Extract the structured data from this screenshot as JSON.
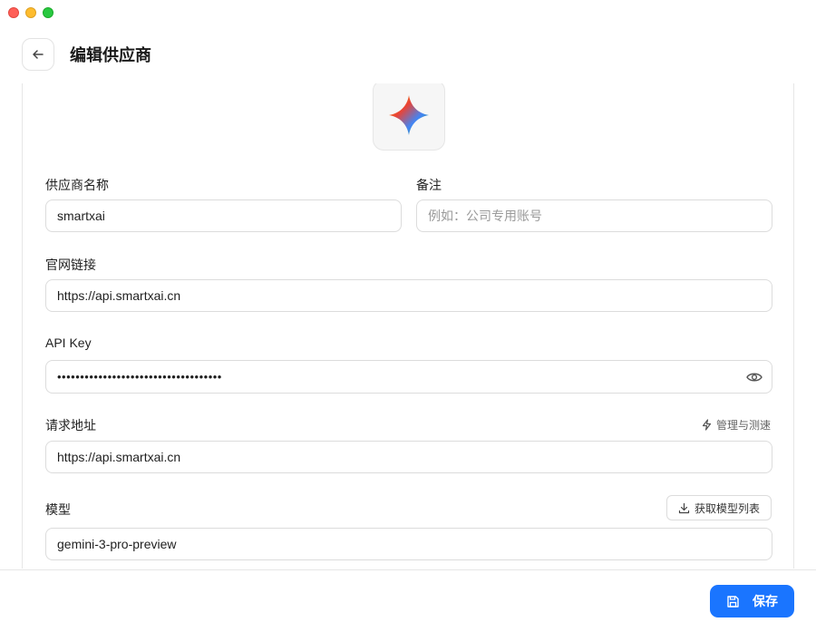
{
  "header": {
    "title": "编辑供应商"
  },
  "form": {
    "provider_name": {
      "label": "供应商名称",
      "value": "smartxai"
    },
    "note": {
      "label": "备注",
      "placeholder": "例如：公司专用账号"
    },
    "website": {
      "label": "官网链接",
      "value": "https://api.smartxai.cn"
    },
    "api_key": {
      "label": "API Key",
      "value": "••••••••••••••••••••••••••••••••••••"
    },
    "endpoint": {
      "label": "请求地址",
      "value": "https://api.smartxai.cn",
      "action_label": "管理与测速"
    },
    "model": {
      "label": "模型",
      "value": "gemini-3-pro-preview",
      "action_label": "获取模型列表"
    }
  },
  "footer": {
    "save_label": "保存"
  },
  "colors": {
    "accent": "#1a75ff"
  },
  "icons": {
    "back": "arrow-left-icon",
    "logo": "gemini-sparkle-icon",
    "eye": "eye-icon",
    "bolt": "lightning-icon",
    "download": "download-icon",
    "save": "save-disk-icon"
  }
}
